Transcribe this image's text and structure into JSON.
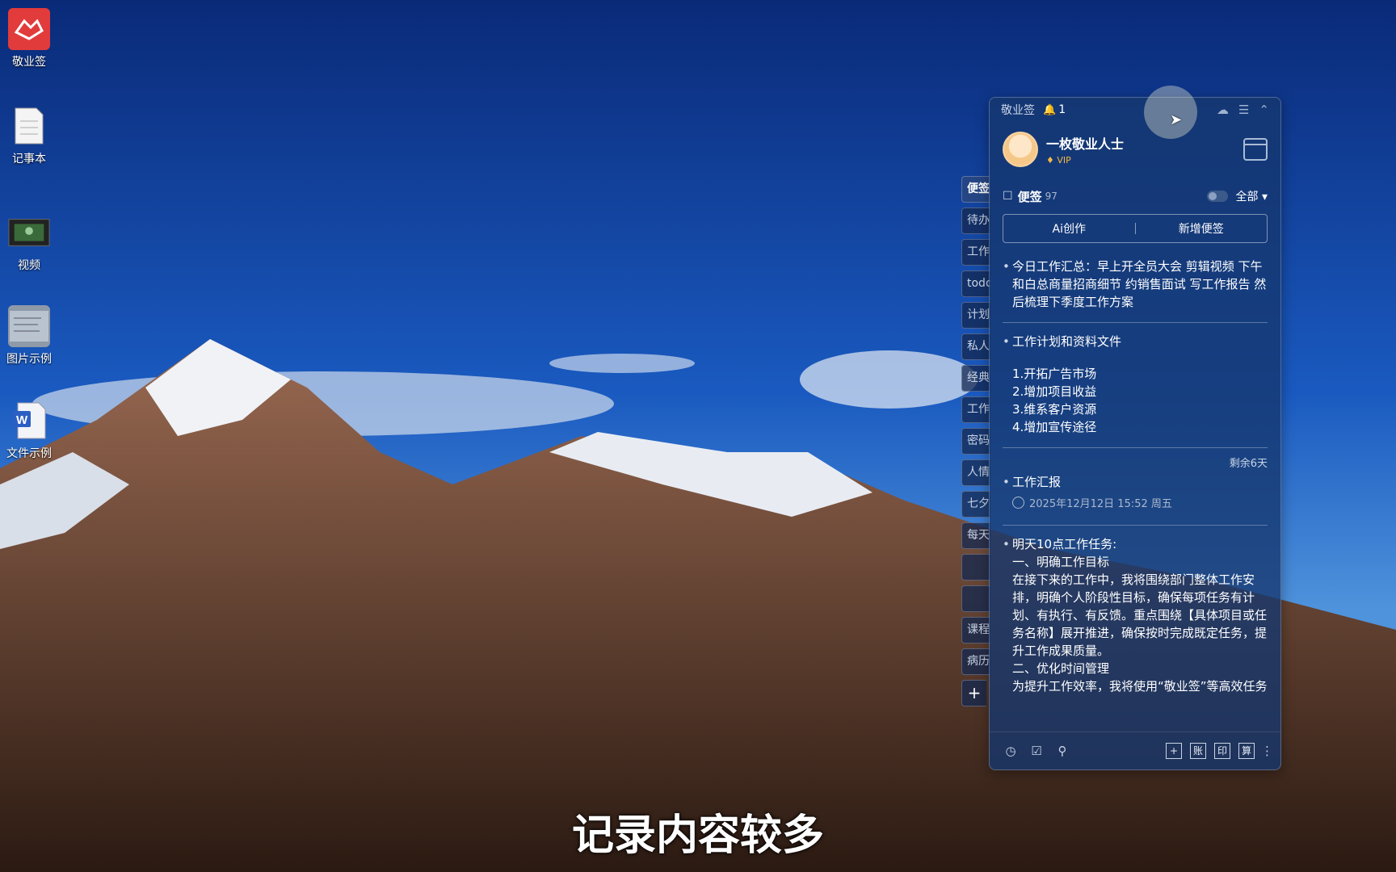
{
  "desktop": {
    "icons": [
      {
        "label": "敬业签"
      },
      {
        "label": "记事本"
      },
      {
        "label": "视频"
      },
      {
        "label": "图片示例"
      },
      {
        "label": "文件示例"
      }
    ]
  },
  "side_tabs": [
    "便签",
    "待办",
    "工作",
    "todo",
    "计划",
    "私人",
    "经典",
    "工作",
    "密码",
    "人情",
    "七夕",
    "每天",
    "",
    "",
    "课程",
    "病历"
  ],
  "panel": {
    "app_name": "敬业签",
    "notification_count": "1",
    "user": {
      "name": "一枚敬业人士",
      "badge": "VIP"
    },
    "notes": {
      "title": "便签",
      "count": "97",
      "filter": "全部"
    },
    "actions": {
      "ai": "Ai创作",
      "new": "新增便签"
    },
    "items": [
      {
        "text": "今日工作汇总：早上开全员大会 剪辑视频 下午和白总商量招商细节 约销售面试 写工作报告 然后梳理下季度工作方案"
      },
      {
        "title": "工作计划和资料文件",
        "body": "1.开拓广告市场\n2.增加项目收益\n3.维系客户资源\n4.增加宣传途径"
      },
      {
        "remaining": "剩余6天",
        "title": "工作汇报",
        "time": "2025年12月12日 15:52 周五"
      },
      {
        "body": "明天10点工作任务:\n一、明确工作目标\n在接下来的工作中，我将围绕部门整体工作安排，明确个人阶段性目标，确保每项任务有计划、有执行、有反馈。重点围绕【具体项目或任务名称】展开推进，确保按时完成既定任务，提升工作成果质量。\n二、优化时间管理\n为提升工作效率，我将使用“敬业签”等高效任务管理工具进行每日任务规划，设"
      }
    ],
    "bottom_tools": [
      "账",
      "印",
      "算"
    ]
  },
  "subtitle": "记录内容较多"
}
